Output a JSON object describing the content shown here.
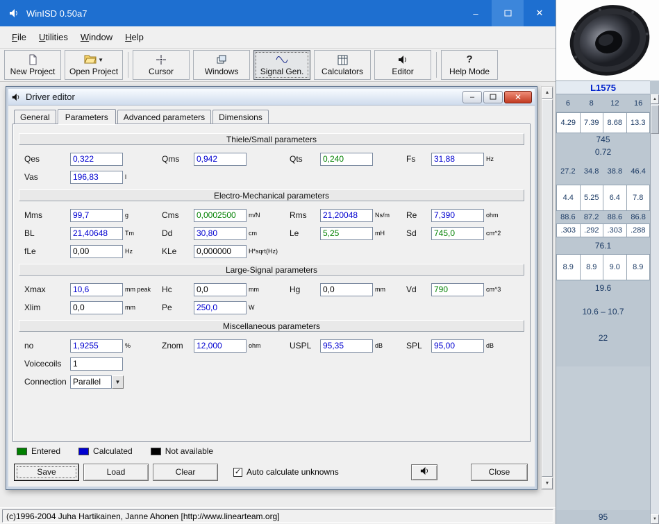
{
  "window": {
    "title": "WinISD 0.50a7"
  },
  "menu": {
    "items": [
      {
        "label": "File"
      },
      {
        "label": "Utilities"
      },
      {
        "label": "Window"
      },
      {
        "label": "Help"
      }
    ]
  },
  "toolbar": {
    "items": [
      {
        "label": "New Project",
        "icon": "new-project-icon"
      },
      {
        "label": "Open Project",
        "icon": "open-folder-icon"
      },
      {
        "label": "Cursor",
        "icon": "cursor-icon"
      },
      {
        "label": "Windows",
        "icon": "windows-icon"
      },
      {
        "label": "Signal Gen.",
        "icon": "signal-generator-icon",
        "active": true
      },
      {
        "label": "Calculators",
        "icon": "calculator-icon"
      },
      {
        "label": "Editor",
        "icon": "speaker-icon"
      },
      {
        "label": "Help Mode",
        "icon": "question-icon"
      }
    ]
  },
  "dialog": {
    "title": "Driver editor",
    "tabs": [
      {
        "label": "General"
      },
      {
        "label": "Parameters",
        "active": true
      },
      {
        "label": "Advanced parameters"
      },
      {
        "label": "Dimensions"
      }
    ],
    "sections": {
      "thiele": "Thiele/Small parameters",
      "electro": "Electro-Mechanical parameters",
      "large_signal": "Large-Signal parameters",
      "misc": "Miscellaneous parameters"
    },
    "fields": {
      "qes": {
        "label": "Qes",
        "value": "0,322",
        "unit": "",
        "color": "#0000d0"
      },
      "vas": {
        "label": "Vas",
        "value": "196,83",
        "unit": "l",
        "color": "#0000d0"
      },
      "qms": {
        "label": "Qms",
        "value": "0,942",
        "unit": "",
        "color": "#0000d0"
      },
      "qts": {
        "label": "Qts",
        "value": "0,240",
        "unit": "",
        "color": "#008000"
      },
      "fs": {
        "label": "Fs",
        "value": "31,88",
        "unit": "Hz",
        "color": "#0000d0"
      },
      "mms": {
        "label": "Mms",
        "value": "99,7",
        "unit": "g",
        "color": "#0000d0"
      },
      "cms": {
        "label": "Cms",
        "value": "0,0002500",
        "unit": "m/N",
        "color": "#008000"
      },
      "rms": {
        "label": "Rms",
        "value": "21,20048",
        "unit": "Ns/m",
        "color": "#0000d0"
      },
      "re": {
        "label": "Re",
        "value": "7,390",
        "unit": "ohm",
        "color": "#0000d0"
      },
      "bl": {
        "label": "BL",
        "value": "21,40648",
        "unit": "Tm",
        "color": "#0000d0"
      },
      "dd": {
        "label": "Dd",
        "value": "30,80",
        "unit": "cm",
        "color": "#0000d0"
      },
      "le": {
        "label": "Le",
        "value": "5,25",
        "unit": "mH",
        "color": "#008000"
      },
      "sd": {
        "label": "Sd",
        "value": "745,0",
        "unit": "cm^2",
        "color": "#008000"
      },
      "fle": {
        "label": "fLe",
        "value": "0,00",
        "unit": "Hz",
        "color": "#000000"
      },
      "kle": {
        "label": "KLe",
        "value": "0,000000",
        "unit": "H*sqrt(Hz)",
        "color": "#000000"
      },
      "xmax": {
        "label": "Xmax",
        "value": "10,6",
        "unit": "mm peak",
        "color": "#0000d0"
      },
      "hc": {
        "label": "Hc",
        "value": "0,0",
        "unit": "mm",
        "color": "#000000"
      },
      "hg": {
        "label": "Hg",
        "value": "0,0",
        "unit": "mm",
        "color": "#000000"
      },
      "vd": {
        "label": "Vd",
        "value": "790",
        "unit": "cm^3",
        "color": "#008000"
      },
      "xlim": {
        "label": "Xlim",
        "value": "0,0",
        "unit": "mm",
        "color": "#000000"
      },
      "pe": {
        "label": "Pe",
        "value": "250,0",
        "unit": "W",
        "color": "#0000d0"
      },
      "no": {
        "label": "no",
        "value": "1,9255",
        "unit": "%",
        "color": "#0000d0"
      },
      "znom": {
        "label": "Znom",
        "value": "12,000",
        "unit": "ohm",
        "color": "#0000d0"
      },
      "uspl": {
        "label": "USPL",
        "value": "95,35",
        "unit": "dB",
        "color": "#0000d0"
      },
      "spl": {
        "label": "SPL",
        "value": "95,00",
        "unit": "dB",
        "color": "#0000d0"
      },
      "voicecoils": {
        "label": "Voicecoils",
        "value": "1",
        "unit": "",
        "color": "#000000"
      },
      "connection": {
        "label": "Connection",
        "value": "Parallel",
        "unit": "",
        "color": "#000000"
      }
    },
    "legend": [
      {
        "label": "Entered",
        "color": "#008000"
      },
      {
        "label": "Calculated",
        "color": "#0000d0"
      },
      {
        "label": "Not available",
        "color": "#000000"
      }
    ],
    "auto_calc_label": "Auto calculate unknowns",
    "auto_calc_checked": true,
    "buttons": {
      "save": "Save",
      "load": "Load",
      "clear": "Clear",
      "close": "Close"
    }
  },
  "status": {
    "text": "(c)1996-2004 Juha Hartikainen, Janne Ahonen [http://www.linearteam.org]"
  },
  "driver_panel": {
    "model": "L1575",
    "rows": [
      {
        "cells": [
          "6",
          "8",
          "12",
          "16"
        ]
      },
      {
        "cells": [
          "4.29",
          "7.39",
          "8.68",
          "13.3"
        ]
      },
      {
        "cells": [
          "745"
        ]
      },
      {
        "cells": [
          "0.72"
        ]
      },
      {
        "cells": [
          "27.2",
          "34.8",
          "38.8",
          "46.4"
        ]
      },
      {
        "cells": [
          "4.4",
          "5.25",
          "6.4",
          "7.8"
        ]
      },
      {
        "cells": [
          "88.6",
          "87.2",
          "88.6",
          "86.8"
        ]
      },
      {
        "cells": [
          ".303",
          ".292",
          ".303",
          ".288"
        ]
      },
      {
        "cells": [
          "76.1"
        ]
      },
      {
        "cells": [
          "8.9",
          "8.9",
          "9.0",
          "8.9"
        ]
      },
      {
        "cells": [
          "19.6"
        ]
      },
      {
        "cells": [
          "10.6 – 10.7"
        ]
      },
      {
        "cells": [
          "22"
        ]
      },
      {
        "cells": [
          "95"
        ]
      }
    ]
  }
}
